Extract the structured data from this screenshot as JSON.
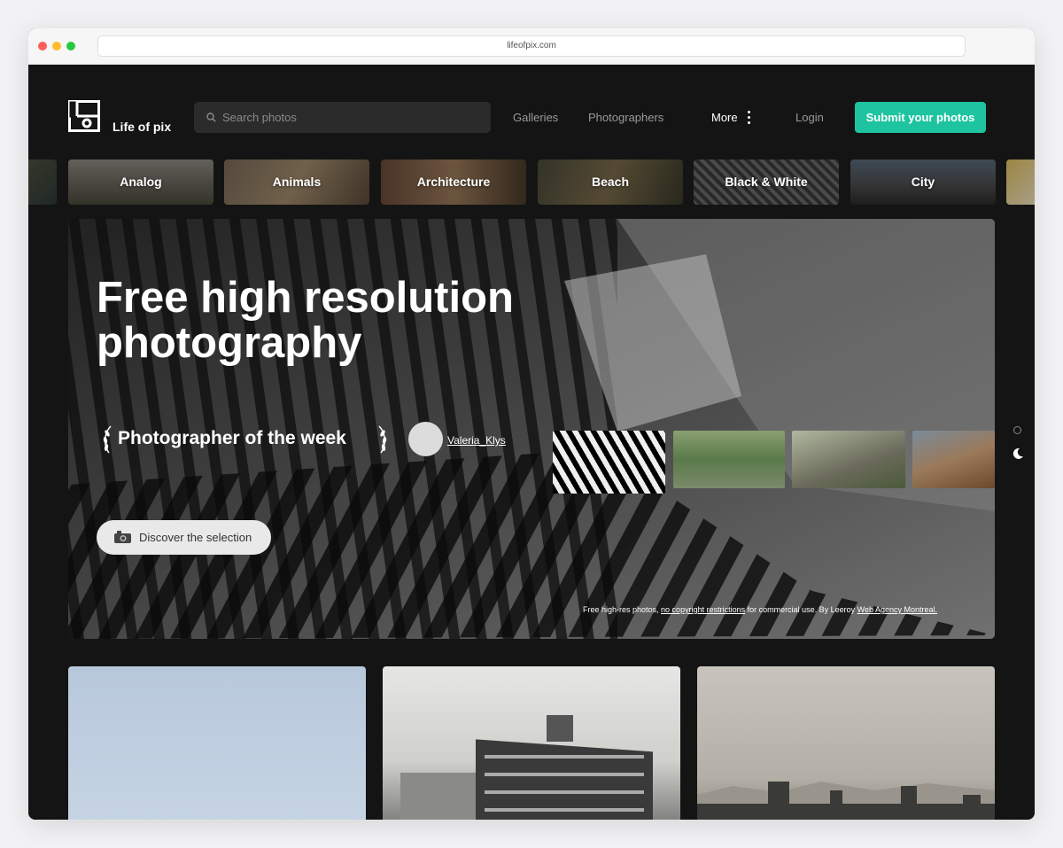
{
  "browser": {
    "url": "lifeofpix.com"
  },
  "header": {
    "brand": "Life of pix",
    "search_placeholder": "Search photos",
    "nav": {
      "galleries": "Galleries",
      "photographers": "Photographers",
      "more": "More",
      "login": "Login"
    },
    "submit_label": "Submit your photos"
  },
  "categories": [
    "Analog",
    "Animals",
    "Architecture",
    "Beach",
    "Black & White",
    "City"
  ],
  "hero": {
    "title": "Free high resolution photography",
    "potw_label": "Photographer of the week",
    "photographer": "Valeria_Klys",
    "discover_label": "Discover the selection",
    "credit": {
      "prefix": "Free high-res photos, ",
      "link1": "no copyright restrictions",
      "middle": " for commercial use. By Leeroy ",
      "link2": "Web Agency Montreal."
    }
  },
  "colors": {
    "accent": "#1ec4a0",
    "page_bg": "#141414"
  },
  "icons": {
    "search": "search-icon",
    "more": "kebab-icon",
    "camera": "camera-icon",
    "theme": "moon-icon"
  }
}
